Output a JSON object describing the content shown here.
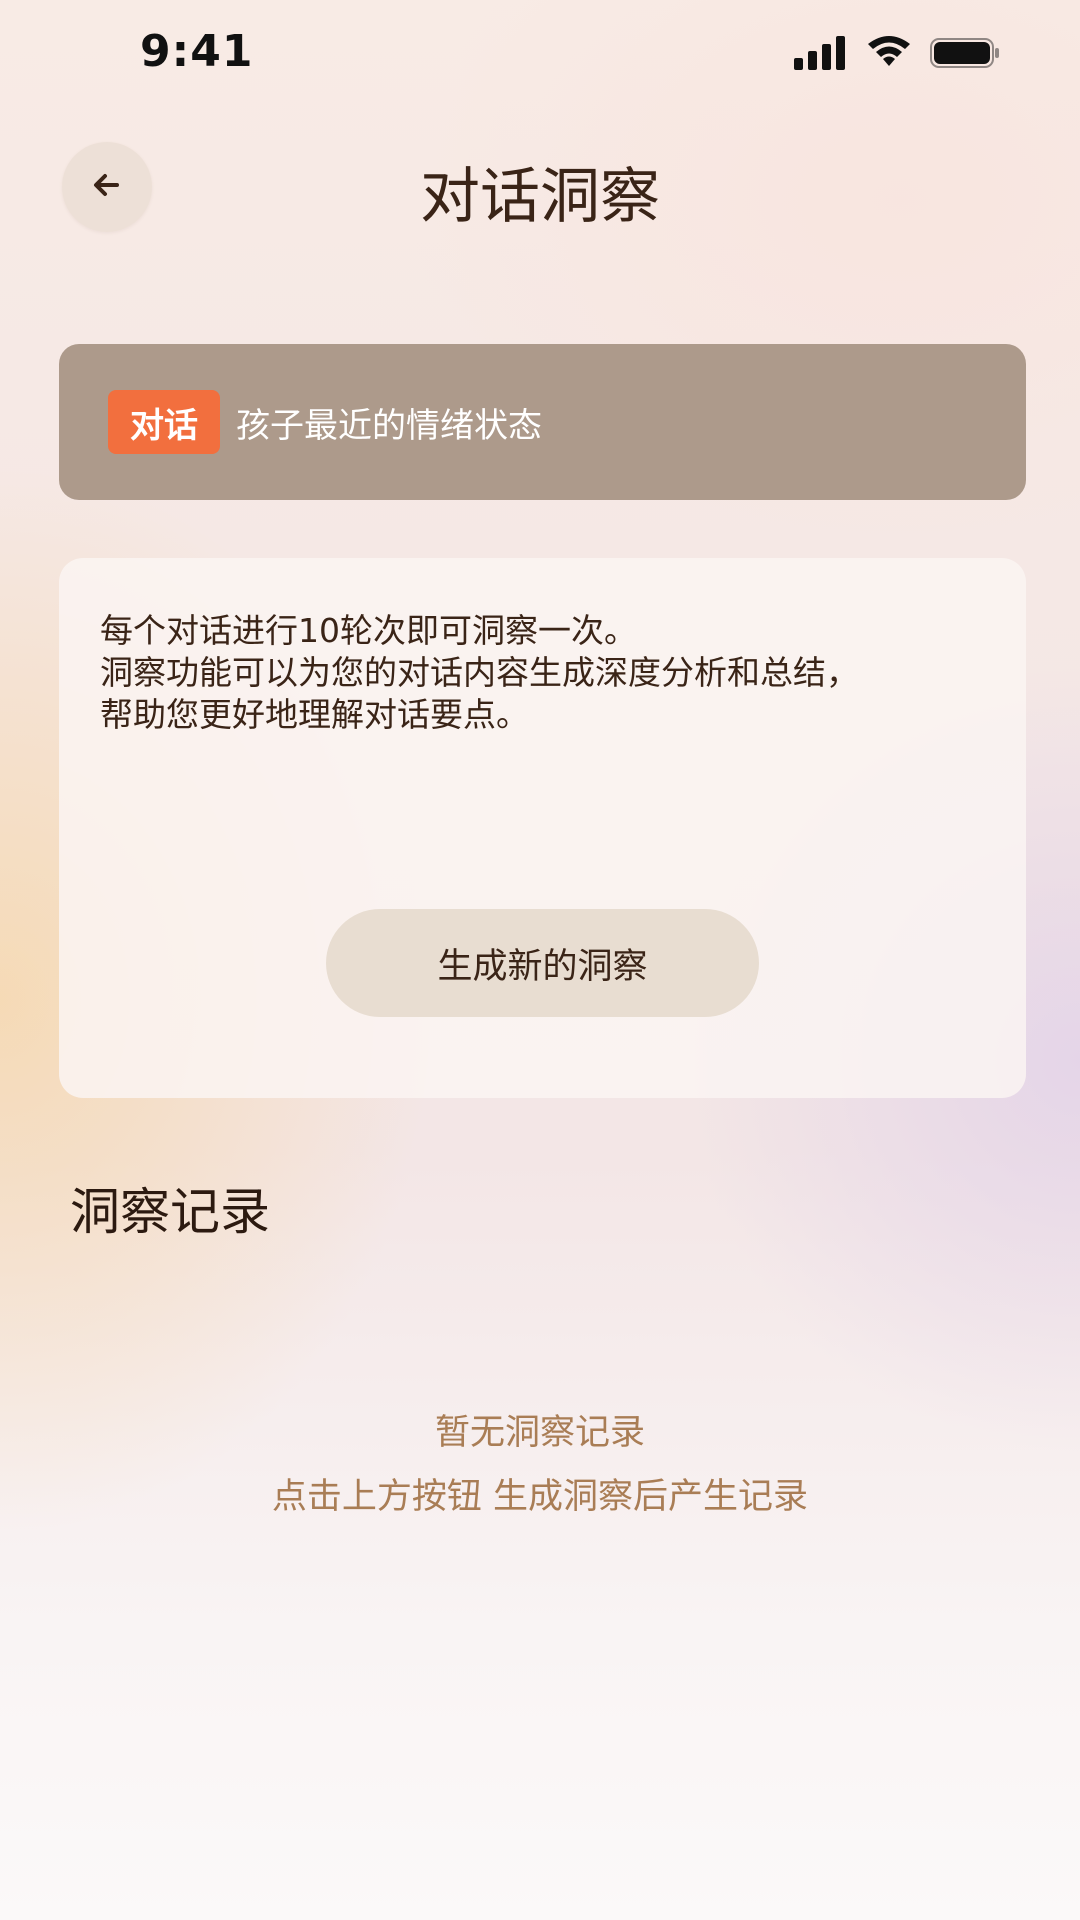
{
  "status_bar": {
    "time": "9:41",
    "icons": [
      "signal-icon",
      "wifi-icon",
      "battery-icon"
    ]
  },
  "header": {
    "back_icon": "arrow-left-icon",
    "title": "对话洞察"
  },
  "topic": {
    "tag": "对话",
    "text": "孩子最近的情绪状态",
    "tag_color": "#f26f3e",
    "banner_color": "#ad9a8b"
  },
  "info_card": {
    "lines": [
      "每个对话进行10轮次即可洞察一次。",
      "洞察功能可以为您的对话内容生成深度分析和总结，",
      "帮助您更好地理解对话要点。"
    ],
    "button_label": "生成新的洞察"
  },
  "records": {
    "title": "洞察记录",
    "empty_title": "暂无洞察记录",
    "empty_hint": "点击上方按钮 生成洞察后产生记录"
  }
}
